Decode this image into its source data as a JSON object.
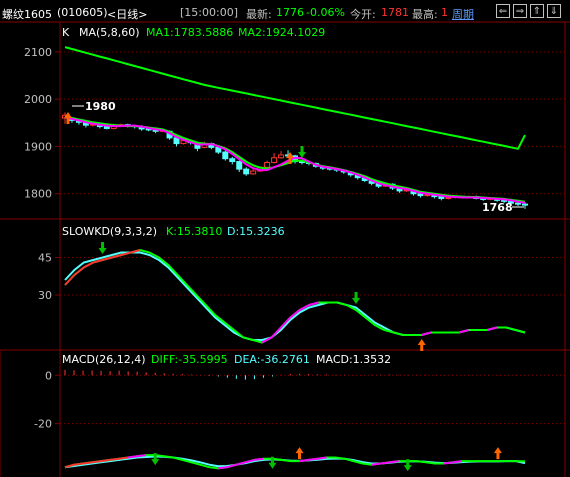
{
  "header": {
    "symbol": "螺纹1605",
    "code": "(010605)",
    "period": "<日线>",
    "time": "[15:00:00]",
    "latest_label": "最新:",
    "latest_value": "1776",
    "change": "-0.06%",
    "open_label": "今开:",
    "open_value": "1781",
    "high_label": "最高:",
    "high_value": "1",
    "cycle_label": "周期",
    "btn_left": "⇐",
    "btn_right": "⇒",
    "btn_up": "⇑",
    "btn_down": "⇓"
  },
  "colors": {
    "background": "#000000",
    "grid": "#800000",
    "up": "#ff3232",
    "down": "#54ffff",
    "ma5": "#ff00ff",
    "ma8": "#ffff00",
    "ma60": "#00ff00",
    "label_white": "#ffffff",
    "label_red": "#ff3232",
    "label_green": "#00ff00",
    "label_cyan": "#54ffff",
    "label_magenta": "#ff00ff"
  },
  "chart_data": [
    {
      "type": "candlestick",
      "title": "K",
      "indicator_label": "MA(5,8,60)",
      "ma1_label": "MA1:1783.5886",
      "ma2_label": "MA2:1924.1029",
      "y_ticks": [
        2100,
        2000,
        1900,
        1800
      ],
      "ylim": [
        1755,
        2125
      ],
      "high_marker": "1980",
      "low_marker": "1768",
      "candles": [
        [
          1960,
          1966,
          1948,
          1972
        ],
        [
          1960,
          1955,
          1950,
          1962
        ],
        [
          1956,
          1951,
          1946,
          1958
        ],
        [
          1950,
          1945,
          1940,
          1953
        ],
        [
          1945,
          1947,
          1942,
          1950
        ],
        [
          1947,
          1942,
          1938,
          1950
        ],
        [
          1942,
          1938,
          1936,
          1945
        ],
        [
          1938,
          1946,
          1936,
          1948
        ],
        [
          1946,
          1946,
          1943,
          1948
        ],
        [
          1946,
          1944,
          1940,
          1948
        ],
        [
          1944,
          1942,
          1938,
          1946
        ],
        [
          1942,
          1937,
          1933,
          1945
        ],
        [
          1937,
          1935,
          1932,
          1940
        ],
        [
          1935,
          1932,
          1928,
          1937
        ],
        [
          1932,
          1934,
          1930,
          1936
        ],
        [
          1932,
          1918,
          1914,
          1934
        ],
        [
          1918,
          1906,
          1900,
          1920
        ],
        [
          1906,
          1912,
          1904,
          1915
        ],
        [
          1912,
          1908,
          1904,
          1914
        ],
        [
          1908,
          1896,
          1890,
          1910
        ],
        [
          1898,
          1906,
          1896,
          1910
        ],
        [
          1906,
          1898,
          1894,
          1908
        ],
        [
          1898,
          1888,
          1884,
          1900
        ],
        [
          1888,
          1874,
          1870,
          1892
        ],
        [
          1874,
          1868,
          1862,
          1878
        ],
        [
          1868,
          1852,
          1846,
          1870
        ],
        [
          1852,
          1842,
          1838,
          1856
        ],
        [
          1842,
          1848,
          1840,
          1852
        ],
        [
          1848,
          1856,
          1846,
          1858
        ],
        [
          1856,
          1866,
          1854,
          1870
        ],
        [
          1866,
          1876,
          1864,
          1886
        ],
        [
          1876,
          1882,
          1874,
          1890
        ],
        [
          1882,
          1880,
          1876,
          1892
        ],
        [
          1880,
          1868,
          1864,
          1882
        ],
        [
          1868,
          1866,
          1862,
          1872
        ],
        [
          1866,
          1864,
          1860,
          1868
        ],
        [
          1864,
          1858,
          1855,
          1866
        ],
        [
          1858,
          1854,
          1850,
          1860
        ],
        [
          1854,
          1852,
          1849,
          1856
        ],
        [
          1852,
          1850,
          1846,
          1854
        ],
        [
          1850,
          1846,
          1842,
          1852
        ],
        [
          1846,
          1840,
          1836,
          1848
        ],
        [
          1840,
          1834,
          1830,
          1842
        ],
        [
          1834,
          1828,
          1825,
          1836
        ],
        [
          1828,
          1822,
          1818,
          1830
        ],
        [
          1822,
          1816,
          1812,
          1824
        ],
        [
          1816,
          1820,
          1814,
          1822
        ],
        [
          1820,
          1812,
          1808,
          1822
        ],
        [
          1812,
          1806,
          1802,
          1814
        ],
        [
          1806,
          1808,
          1804,
          1810
        ],
        [
          1806,
          1800,
          1796,
          1808
        ],
        [
          1800,
          1796,
          1792,
          1802
        ],
        [
          1796,
          1798,
          1794,
          1800
        ],
        [
          1796,
          1794,
          1790,
          1798
        ],
        [
          1794,
          1790,
          1786,
          1796
        ],
        [
          1790,
          1792,
          1788,
          1794
        ],
        [
          1792,
          1794,
          1790,
          1796
        ],
        [
          1794,
          1792,
          1790,
          1796
        ],
        [
          1792,
          1794,
          1791,
          1796
        ],
        [
          1794,
          1790,
          1788,
          1796
        ],
        [
          1790,
          1788,
          1785,
          1792
        ],
        [
          1788,
          1790,
          1786,
          1792
        ],
        [
          1790,
          1786,
          1783,
          1792
        ],
        [
          1786,
          1784,
          1780,
          1788
        ],
        [
          1784,
          1780,
          1775,
          1786
        ],
        [
          1780,
          1778,
          1774,
          1782
        ],
        [
          1778,
          1776,
          1768,
          1781
        ]
      ],
      "ma5": [
        1962,
        1958,
        1955,
        1951,
        1948,
        1946,
        1944,
        1943,
        1943,
        1944,
        1944,
        1942,
        1939,
        1936,
        1934,
        1928,
        1920,
        1914,
        1909,
        1904,
        1904,
        1905,
        1900,
        1894,
        1884,
        1873,
        1862,
        1854,
        1850,
        1850,
        1856,
        1862,
        1870,
        1876,
        1875,
        1868,
        1861,
        1857,
        1855,
        1852,
        1849,
        1845,
        1840,
        1834,
        1828,
        1822,
        1818,
        1815,
        1812,
        1810,
        1806,
        1802,
        1800,
        1798,
        1796,
        1794,
        1793,
        1792,
        1792,
        1792,
        1791,
        1790,
        1789,
        1788,
        1786,
        1783,
        1781
      ],
      "ma8": [
        1963,
        1960,
        1957,
        1954,
        1951,
        1949,
        1947,
        1945,
        1944,
        1943,
        1943,
        1942,
        1940,
        1938,
        1936,
        1931,
        1924,
        1918,
        1913,
        1908,
        1906,
        1905,
        1901,
        1896,
        1888,
        1878,
        1868,
        1860,
        1855,
        1853,
        1856,
        1860,
        1865,
        1870,
        1870,
        1866,
        1862,
        1858,
        1856,
        1853,
        1850,
        1846,
        1842,
        1837,
        1831,
        1826,
        1822,
        1818,
        1815,
        1812,
        1808,
        1804,
        1802,
        1800,
        1798,
        1796,
        1795,
        1794,
        1793,
        1793,
        1792,
        1791,
        1790,
        1789,
        1787,
        1785,
        1783
      ],
      "ma60": [
        2110,
        2106,
        2102,
        2098,
        2094,
        2090,
        2086,
        2082,
        2078,
        2074,
        2070,
        2066,
        2062,
        2058,
        2054,
        2050,
        2046,
        2042,
        2038,
        2034,
        2030,
        2027,
        2024,
        2021,
        2018,
        2015,
        2012,
        2009,
        2006,
        2003,
        2000,
        1997,
        1994,
        1991,
        1988,
        1985,
        1982,
        1979,
        1976,
        1973,
        1970,
        1967,
        1964,
        1961,
        1958,
        1955,
        1952,
        1949,
        1946,
        1943,
        1940,
        1937,
        1934,
        1931,
        1928,
        1925,
        1922,
        1919,
        1916,
        1913,
        1910,
        1907,
        1904,
        1901,
        1898,
        1895,
        1924
      ]
    },
    {
      "type": "line",
      "title": "SLOWKD(9,3,3,2)",
      "k_label": "K:15.3810",
      "d_label": "D:15.3236",
      "y_ticks": [
        45,
        30
      ],
      "ylim": [
        10,
        52
      ],
      "series": [
        {
          "name": "K",
          "values": [
            34,
            38,
            41,
            43,
            44,
            45,
            46,
            47,
            48,
            47,
            45,
            42,
            38,
            34,
            30,
            26,
            22,
            19,
            16,
            13,
            12,
            11,
            13,
            17,
            21,
            24,
            26,
            27,
            27,
            27,
            26,
            24,
            21,
            18,
            16,
            15,
            14,
            14,
            14,
            15,
            15,
            15,
            15,
            16,
            16,
            16,
            17,
            17,
            16,
            15
          ]
        },
        {
          "name": "D",
          "values": [
            36,
            40,
            43,
            44,
            45,
            46,
            47,
            47,
            47,
            46,
            44,
            41,
            37,
            33,
            29,
            25,
            21,
            18,
            15,
            13,
            12,
            12,
            13,
            16,
            20,
            23,
            25,
            26,
            27,
            27,
            26,
            25,
            22,
            19,
            17,
            15,
            14,
            14,
            14,
            15,
            15,
            15,
            15,
            16,
            16,
            16,
            17,
            17,
            16,
            15
          ]
        }
      ],
      "arrows_down": [
        4,
        31,
        52
      ],
      "arrows_up": [
        38,
        50
      ]
    },
    {
      "type": "bar",
      "title": "MACD(26,12,4)",
      "diff_label": "DIFF:-35.5995",
      "dea_label": "DEA:-36.2761",
      "macd_label": "MACD:1.3532",
      "y_ticks": [
        0,
        -20
      ],
      "ylim": [
        -40,
        3
      ],
      "macd": [
        2.2,
        2.1,
        1.9,
        2.0,
        1.8,
        1.7,
        1.9,
        1.6,
        1.5,
        1.2,
        1.0,
        0.8,
        0.6,
        0.5,
        0.3,
        0.1,
        -0.2,
        -0.5,
        -1.0,
        -1.5,
        -1.8,
        -1.6,
        -1.0,
        -0.5,
        0.2,
        0.5,
        0.6,
        0.5,
        0.4,
        0.3,
        0.2,
        0.2,
        0.1,
        0.1,
        0.2,
        0.2,
        0.3,
        0.2,
        0.2,
        0.1,
        0.2,
        0.1,
        0.1,
        0.1,
        0.1,
        0.1,
        0.0,
        0.1,
        0.1,
        0.1,
        0.1,
        0.1
      ],
      "diff": [
        -38,
        -37,
        -36.5,
        -36,
        -35.5,
        -35,
        -34.5,
        -34,
        -33.5,
        -33,
        -33,
        -33.5,
        -34,
        -35,
        -36,
        -37,
        -38,
        -38.5,
        -38,
        -37,
        -36,
        -35,
        -34.5,
        -34.5,
        -35,
        -35.5,
        -35.5,
        -35,
        -34.5,
        -34,
        -34,
        -34.5,
        -35.5,
        -36.5,
        -37,
        -36.5,
        -36,
        -35.5,
        -35.5,
        -35.5,
        -36,
        -36.5,
        -36.5,
        -36,
        -35.5,
        -35.5,
        -35.5,
        -35.5,
        -35.5,
        -35.5,
        -35.5,
        -35.6
      ],
      "dea": [
        -38,
        -37.5,
        -37,
        -36.5,
        -36,
        -35.5,
        -35,
        -34.5,
        -34,
        -33.8,
        -33.6,
        -33.7,
        -34,
        -34.5,
        -35.2,
        -36,
        -37,
        -37.6,
        -37.5,
        -37,
        -36.3,
        -35.5,
        -35,
        -34.8,
        -35,
        -35.3,
        -35.4,
        -35.2,
        -34.9,
        -34.6,
        -34.4,
        -34.5,
        -35.1,
        -35.9,
        -36.5,
        -36.5,
        -36.2,
        -35.8,
        -35.6,
        -35.6,
        -35.8,
        -36.1,
        -36.3,
        -36.2,
        -35.9,
        -35.7,
        -35.6,
        -35.6,
        -35.6,
        -35.5,
        -35.5,
        -36.3
      ],
      "arrows_down": [
        10,
        23,
        38
      ],
      "arrows_up": [
        26,
        48
      ]
    }
  ]
}
